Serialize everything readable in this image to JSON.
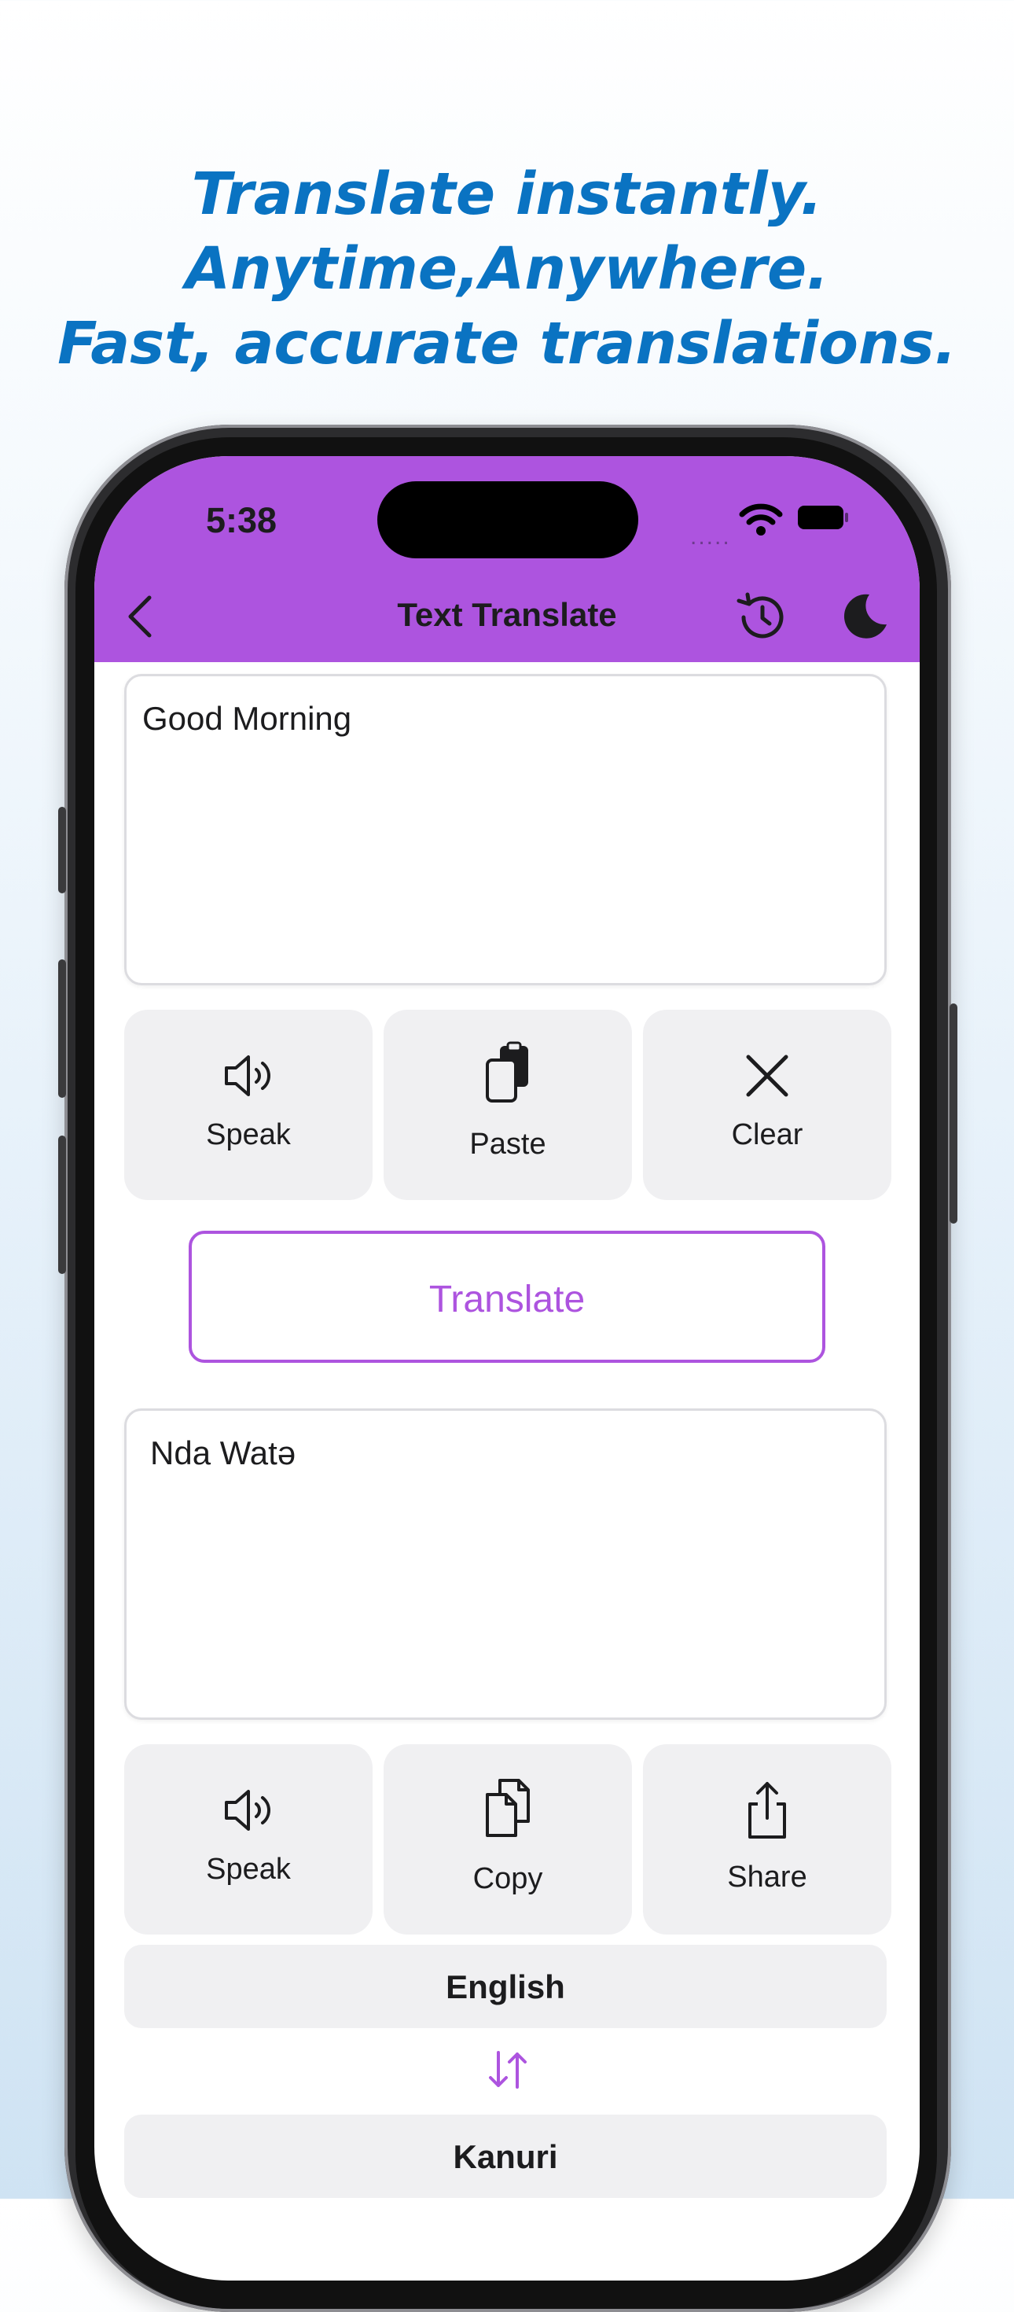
{
  "headline": {
    "line1": "Translate instantly.",
    "line2": "Anytime,Anywhere.",
    "line3": "Fast, accurate translations."
  },
  "status_bar": {
    "time": "5:38",
    "signal": "....."
  },
  "nav": {
    "title": "Text Translate"
  },
  "input": {
    "text": "Good Morning"
  },
  "input_actions": {
    "speak": "Speak",
    "paste": "Paste",
    "clear": "Clear"
  },
  "translate_button": "Translate",
  "output": {
    "text": "Nda Watə"
  },
  "output_actions": {
    "speak": "Speak",
    "copy": "Copy",
    "share": "Share"
  },
  "languages": {
    "source": "English",
    "target": "Kanuri"
  },
  "colors": {
    "accent": "#ad54df",
    "headline": "#0a73c2",
    "button_bg": "#f0f0f2"
  },
  "icons": [
    "back-icon",
    "history-icon",
    "moon-icon",
    "speaker-icon",
    "paste-icon",
    "close-icon",
    "copy-icon",
    "share-icon",
    "swap-icon",
    "wifi-icon",
    "battery-icon"
  ]
}
